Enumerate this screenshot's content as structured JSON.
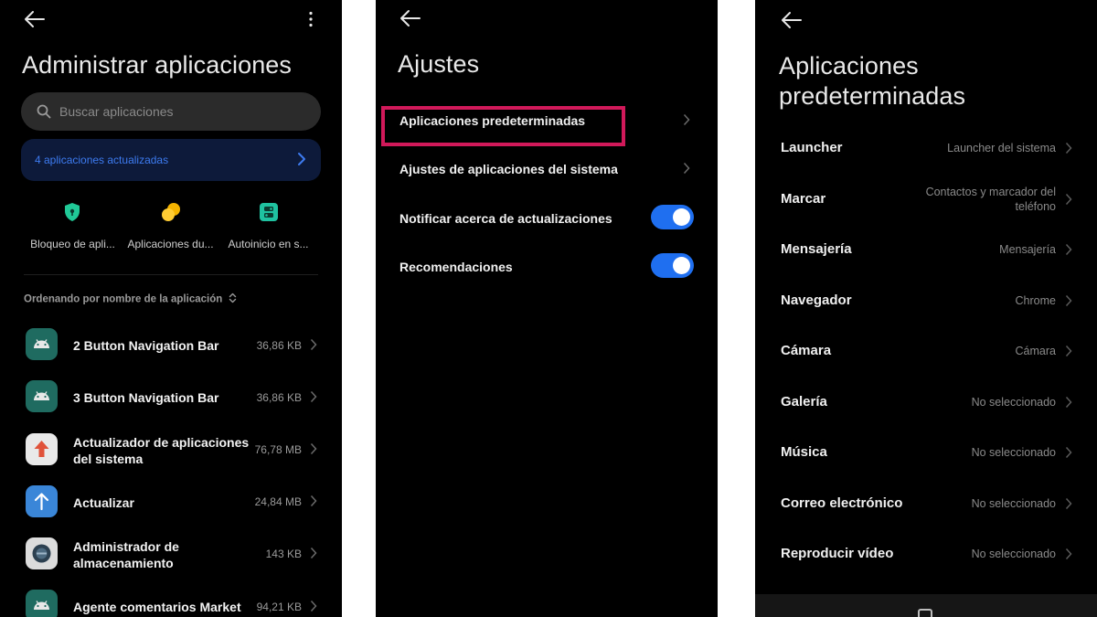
{
  "panels": {
    "manage_apps": {
      "title": "Administrar aplicaciones",
      "search_placeholder": "Buscar aplicaciones",
      "update_banner": "4 aplicaciones actualizadas",
      "quick_actions": [
        {
          "label": "Bloqueo de apli...",
          "icon": "shield-icon",
          "color": "#20c997"
        },
        {
          "label": "Aplicaciones du...",
          "icon": "dual-apps-icon",
          "color": "#f5b400"
        },
        {
          "label": "Autoinicio en s...",
          "icon": "autostart-icon",
          "color": "#1fc2a0"
        }
      ],
      "sort_label": "Ordenando por nombre de la aplicación",
      "apps": [
        {
          "name": "2 Button Navigation Bar",
          "size": "36,86 KB",
          "icon": "android-icon"
        },
        {
          "name": "3 Button Navigation Bar",
          "size": "36,86 KB",
          "icon": "android-icon"
        },
        {
          "name": "Actualizador de aplicaciones del sistema",
          "size": "76,78 MB",
          "icon": "update-arrow-icon"
        },
        {
          "name": "Actualizar",
          "size": "24,84 MB",
          "icon": "upload-icon"
        },
        {
          "name": "Administrador de almacenamiento",
          "size": "143 KB",
          "icon": "storage-icon"
        },
        {
          "name": "Agente comentarios Market",
          "size": "94,21 KB",
          "icon": "android-icon"
        }
      ]
    },
    "settings": {
      "title": "Ajustes",
      "items": [
        {
          "label": "Aplicaciones predeterminadas",
          "control": "chevron",
          "highlighted": true
        },
        {
          "label": "Ajustes de aplicaciones del sistema",
          "control": "chevron"
        },
        {
          "label": "Notificar acerca de actualizaciones",
          "control": "toggle",
          "on": true
        },
        {
          "label": "Recomendaciones",
          "control": "toggle",
          "on": true
        }
      ]
    },
    "default_apps": {
      "title_line1": "Aplicaciones",
      "title_line2": "predeterminadas",
      "items": [
        {
          "label": "Launcher",
          "value_line1": "Launcher del sistema",
          "value_line2": ""
        },
        {
          "label": "Marcar",
          "value_line1": "Contactos y marcador del",
          "value_line2": "teléfono"
        },
        {
          "label": "Mensajería",
          "value_line1": "Mensajería",
          "value_line2": ""
        },
        {
          "label": "Navegador",
          "value_line1": "Chrome",
          "value_line2": ""
        },
        {
          "label": "Cámara",
          "value_line1": "Cámara",
          "value_line2": ""
        },
        {
          "label": "Galería",
          "value_line1": "No seleccionado",
          "value_line2": ""
        },
        {
          "label": "Música",
          "value_line1": "No seleccionado",
          "value_line2": ""
        },
        {
          "label": "Correo electrónico",
          "value_line1": "No seleccionado",
          "value_line2": ""
        },
        {
          "label": "Reproducir vídeo",
          "value_line1": "No seleccionado",
          "value_line2": ""
        }
      ]
    }
  },
  "colors": {
    "background": "#000000",
    "accent_blue": "#1f6ff0",
    "highlight_box": "#d1195a",
    "secondary_text": "#9a9a9a"
  }
}
